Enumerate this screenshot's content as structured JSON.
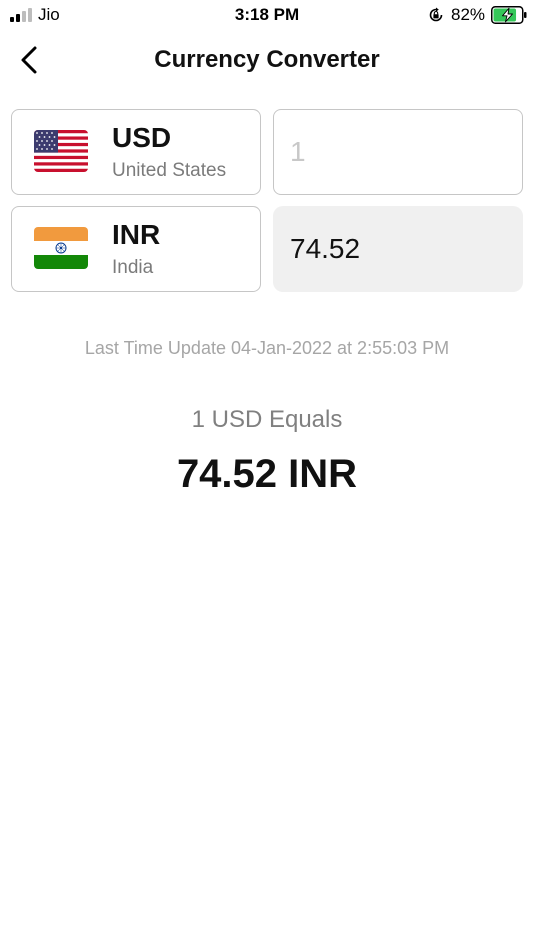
{
  "status_bar": {
    "carrier": "Jio",
    "time": "3:18 PM",
    "battery_percent": "82%",
    "battery_level": 0.82,
    "signal_icon": "cellular-signal-icon",
    "lock_icon": "orientation-lock-icon",
    "battery_icon": "battery-charging-icon",
    "battery_color": "#34c759"
  },
  "nav": {
    "title": "Currency Converter",
    "back_icon": "chevron-left-icon"
  },
  "from_currency": {
    "code": "USD",
    "country": "United States",
    "flag_icon": "us-flag-icon"
  },
  "to_currency": {
    "code": "INR",
    "country": "India",
    "flag_icon": "india-flag-icon"
  },
  "amount": {
    "placeholder": "1",
    "value": ""
  },
  "converted_amount": "74.52",
  "last_update": "Last Time Update 04-Jan-2022 at 2:55:03 PM",
  "equals_label": "1 USD Equals",
  "result": "74.52 INR",
  "colors": {
    "saffron": "#f19a3e",
    "india_green": "#138808",
    "chakra_blue": "#0b3d91",
    "us_red": "#c8102e",
    "us_blue": "#3c3b6e"
  }
}
